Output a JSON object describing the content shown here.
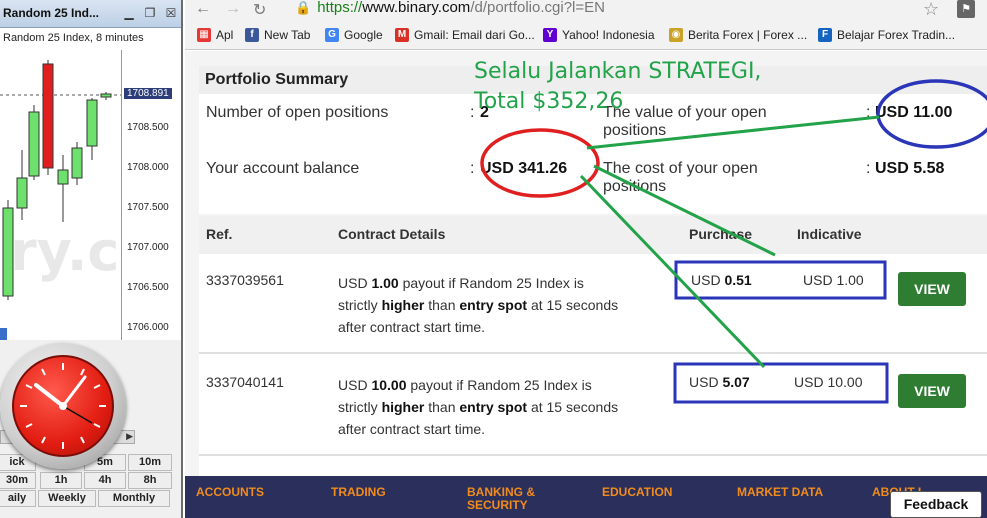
{
  "chart_window": {
    "title": "Random 25 Ind...",
    "subtitle": "Random 25 Index, 8 minutes",
    "price_ticks": [
      "1708.891",
      "1708.500",
      "1708.000",
      "1707.500",
      "1707.000",
      "1706.500",
      "1706.000"
    ],
    "timeframes_row1": [
      "ick",
      "",
      "5m",
      "10m"
    ],
    "timeframes_row2": [
      "30m",
      "1h",
      "4h",
      "8h"
    ],
    "timeframes_row3": [
      "aily",
      "Weekly",
      "Monthly"
    ]
  },
  "browser": {
    "url_protocol": "https://",
    "url_host": "www.binary.com",
    "url_path": "/d/portfolio.cgi?l=EN",
    "bookmarks": [
      {
        "label": "Apl",
        "icon": "apps-icon",
        "color": "#e53935"
      },
      {
        "label": "New Tab",
        "icon": "facebook-icon",
        "color": "#3b5998"
      },
      {
        "label": "Google",
        "icon": "google-icon",
        "color": "#4285f4"
      },
      {
        "label": "Gmail: Email dari Go...",
        "icon": "gmail-icon",
        "color": "#d93025"
      },
      {
        "label": "Yahoo! Indonesia",
        "icon": "yahoo-icon",
        "color": "#5f01d1"
      },
      {
        "label": "Berita Forex | Forex ...",
        "icon": "forex-news-icon",
        "color": "#c9a227"
      },
      {
        "label": "Belajar Forex Tradin...",
        "icon": "forex-learn-icon",
        "color": "#1565c0"
      }
    ]
  },
  "summary": {
    "title": "Portfolio Summary",
    "open_positions_label": "Number of open positions",
    "open_positions_value": "2",
    "value_label": "The value of your open positions",
    "value_value": "USD 11.00",
    "balance_label": "Your account balance",
    "balance_value": "USD 341.26",
    "cost_label": "The cost of your open positions",
    "cost_value": "USD 5.58",
    "colon": ":"
  },
  "annotation": {
    "line1": "Selalu Jalankan STRATEGI,",
    "line2": "Total $352,26"
  },
  "table": {
    "headers": {
      "ref": "Ref.",
      "details": "Contract Details",
      "purchase": "Purchase",
      "indicative": "Indicative"
    },
    "rows": [
      {
        "ref": "3337039561",
        "d1": "USD ",
        "d1b": "1.00",
        "d2": " payout if Random 25 Index is",
        "d3": "strictly ",
        "d3b": "higher",
        "d4": " than ",
        "d4b": "entry spot",
        "d5": " at 15 seconds",
        "d6": "after contract start time.",
        "purchase_cur": "USD ",
        "purchase_val": "0.51",
        "indicative": "USD 1.00",
        "button": "VIEW"
      },
      {
        "ref": "3337040141",
        "d1": "USD ",
        "d1b": "10.00",
        "d2": " payout if Random 25 Index is",
        "d3": "strictly ",
        "d3b": "higher",
        "d4": " than ",
        "d4b": "entry spot",
        "d5": " at 15 seconds",
        "d6": "after contract start time.",
        "purchase_cur": "USD ",
        "purchase_val": "5.07",
        "indicative": "USD 10.00",
        "button": "VIEW"
      }
    ]
  },
  "footer_nav": [
    "ACCOUNTS",
    "TRADING",
    "BANKING &",
    "SECURITY",
    "EDUCATION",
    "MARKET DATA",
    "ABOUT US"
  ],
  "feedback": "Feedback",
  "colors": {
    "accent_green": "#2e7d32",
    "annotation_green": "#22a34a",
    "footer_bg": "#2a2f5c",
    "footer_text": "#f28c1a",
    "circle_red": "#e02020",
    "box_blue": "#2a35b8"
  }
}
